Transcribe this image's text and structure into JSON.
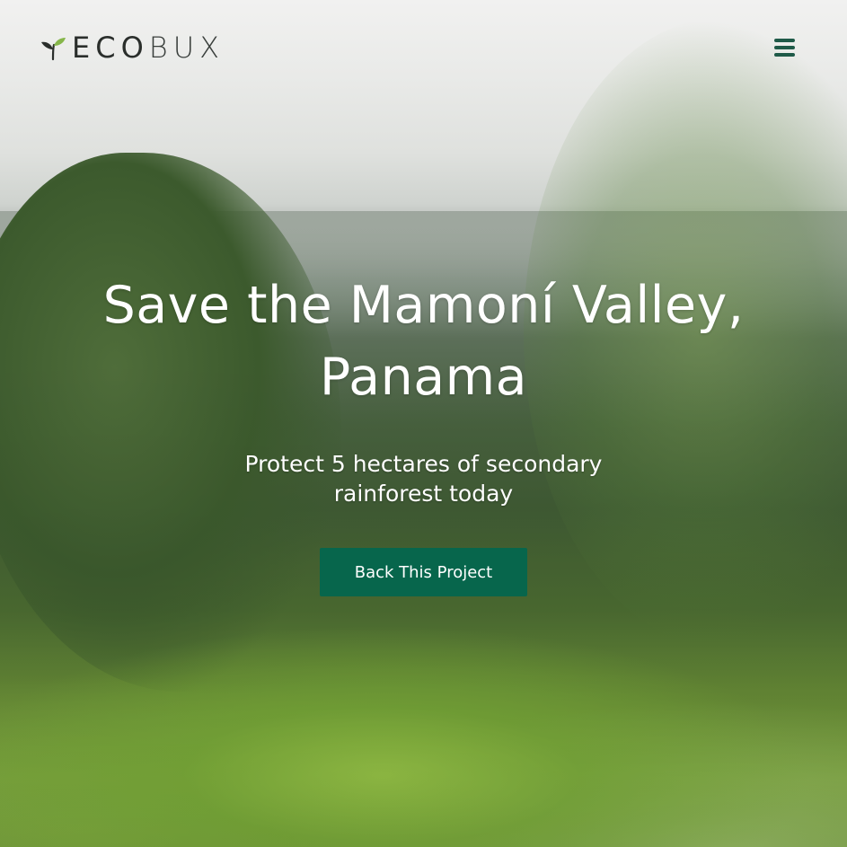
{
  "brand": {
    "name_part1": "ECO",
    "name_part2": "BUX",
    "icon": "leaf-sprout-icon",
    "accent_color": "#07664c"
  },
  "header": {
    "menu_icon": "hamburger-menu-icon"
  },
  "hero": {
    "title": "Save the Mamoní Valley, Panama",
    "subtitle": "Protect 5 hectares of secondary rainforest today",
    "cta_label": "Back This Project",
    "background": "rainforest-valley-photo"
  }
}
